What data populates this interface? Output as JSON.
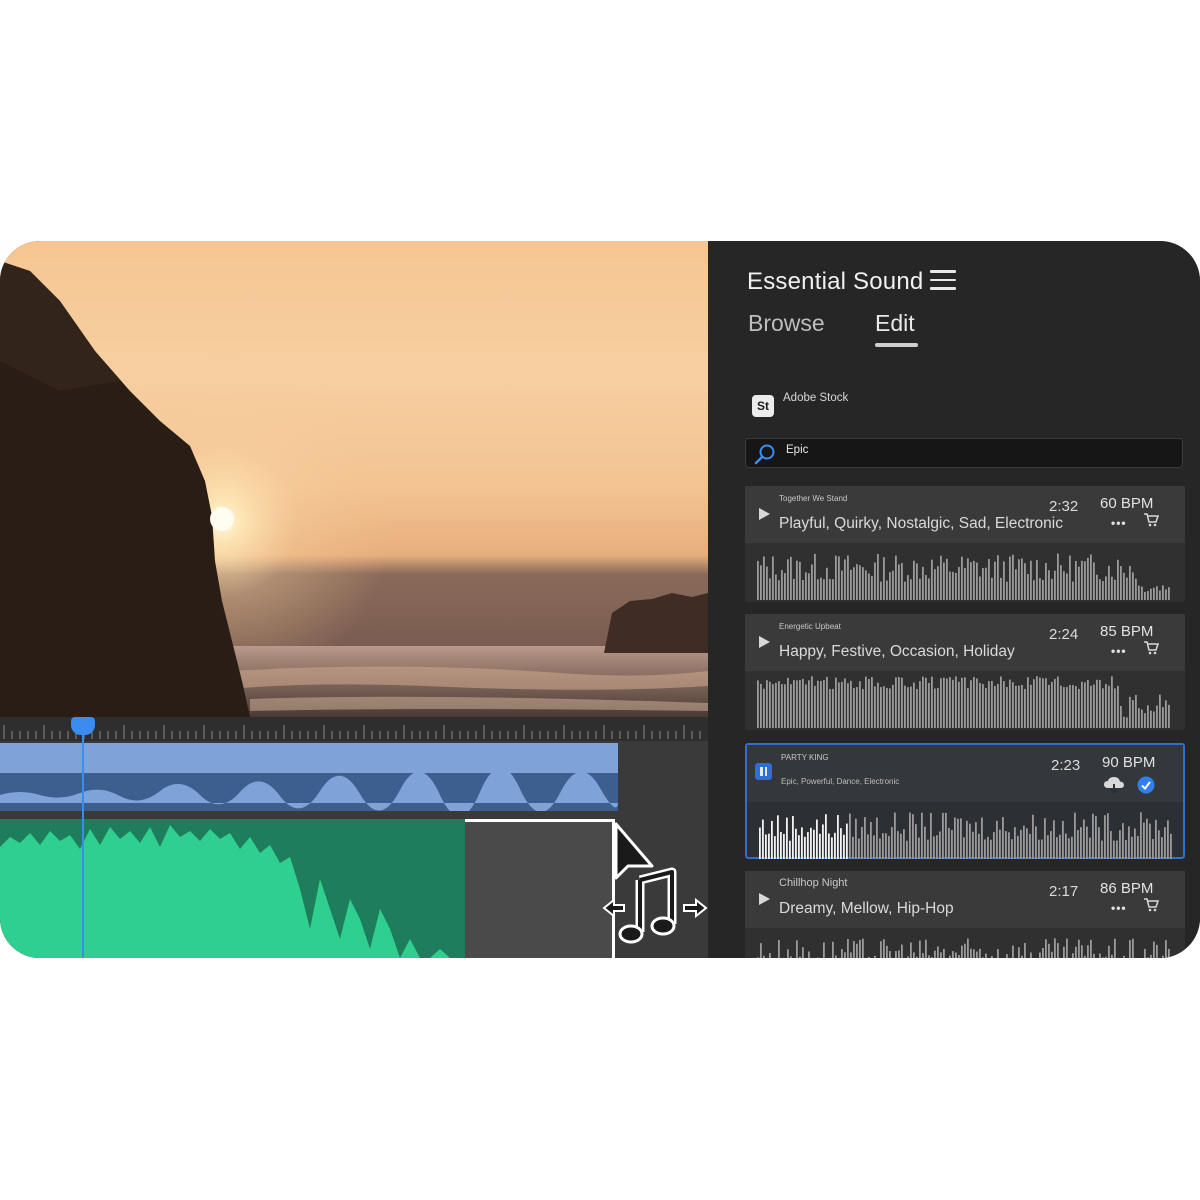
{
  "panel": {
    "title": "Essential Sound",
    "tabs": [
      {
        "label": "Browse",
        "active": false
      },
      {
        "label": "Edit",
        "active": true
      }
    ],
    "source": {
      "badge": "St",
      "label": "Adobe Stock"
    },
    "search": {
      "value": "Epic"
    }
  },
  "tracks": [
    {
      "name": "Together We Stand",
      "tags": "Playful, Quirky, Nostalgic, Sad, Electronic",
      "duration": "2:32",
      "bpm": "60 BPM",
      "state": "idle"
    },
    {
      "name": "Energetic Upbeat",
      "tags": "Happy, Festive, Occasion, Holiday",
      "duration": "2:24",
      "bpm": "85 BPM",
      "state": "idle"
    },
    {
      "name": "PARTY KING",
      "tags": "Epic, Powerful, Dance, Electronic",
      "duration": "2:23",
      "bpm": "90 BPM",
      "state": "playing"
    },
    {
      "name": "Chillhop Night",
      "tags": "Dreamy, Mellow, Hip-Hop",
      "duration": "2:17",
      "bpm": "86 BPM",
      "state": "idle"
    }
  ],
  "icons": {
    "menu": "hamburger-menu-icon",
    "search": "search-icon",
    "play": "play-icon",
    "pause": "pause-icon",
    "more": "more-icon",
    "cart": "cart-icon",
    "cloud": "cloud-download-icon",
    "check": "check-circle-icon",
    "cursor": "drag-music-cursor-icon"
  },
  "colors": {
    "accent": "#2d6fd6",
    "panel_bg": "#262626",
    "music_track": "#2fd08f",
    "video_clip": "#7fa3d8"
  }
}
